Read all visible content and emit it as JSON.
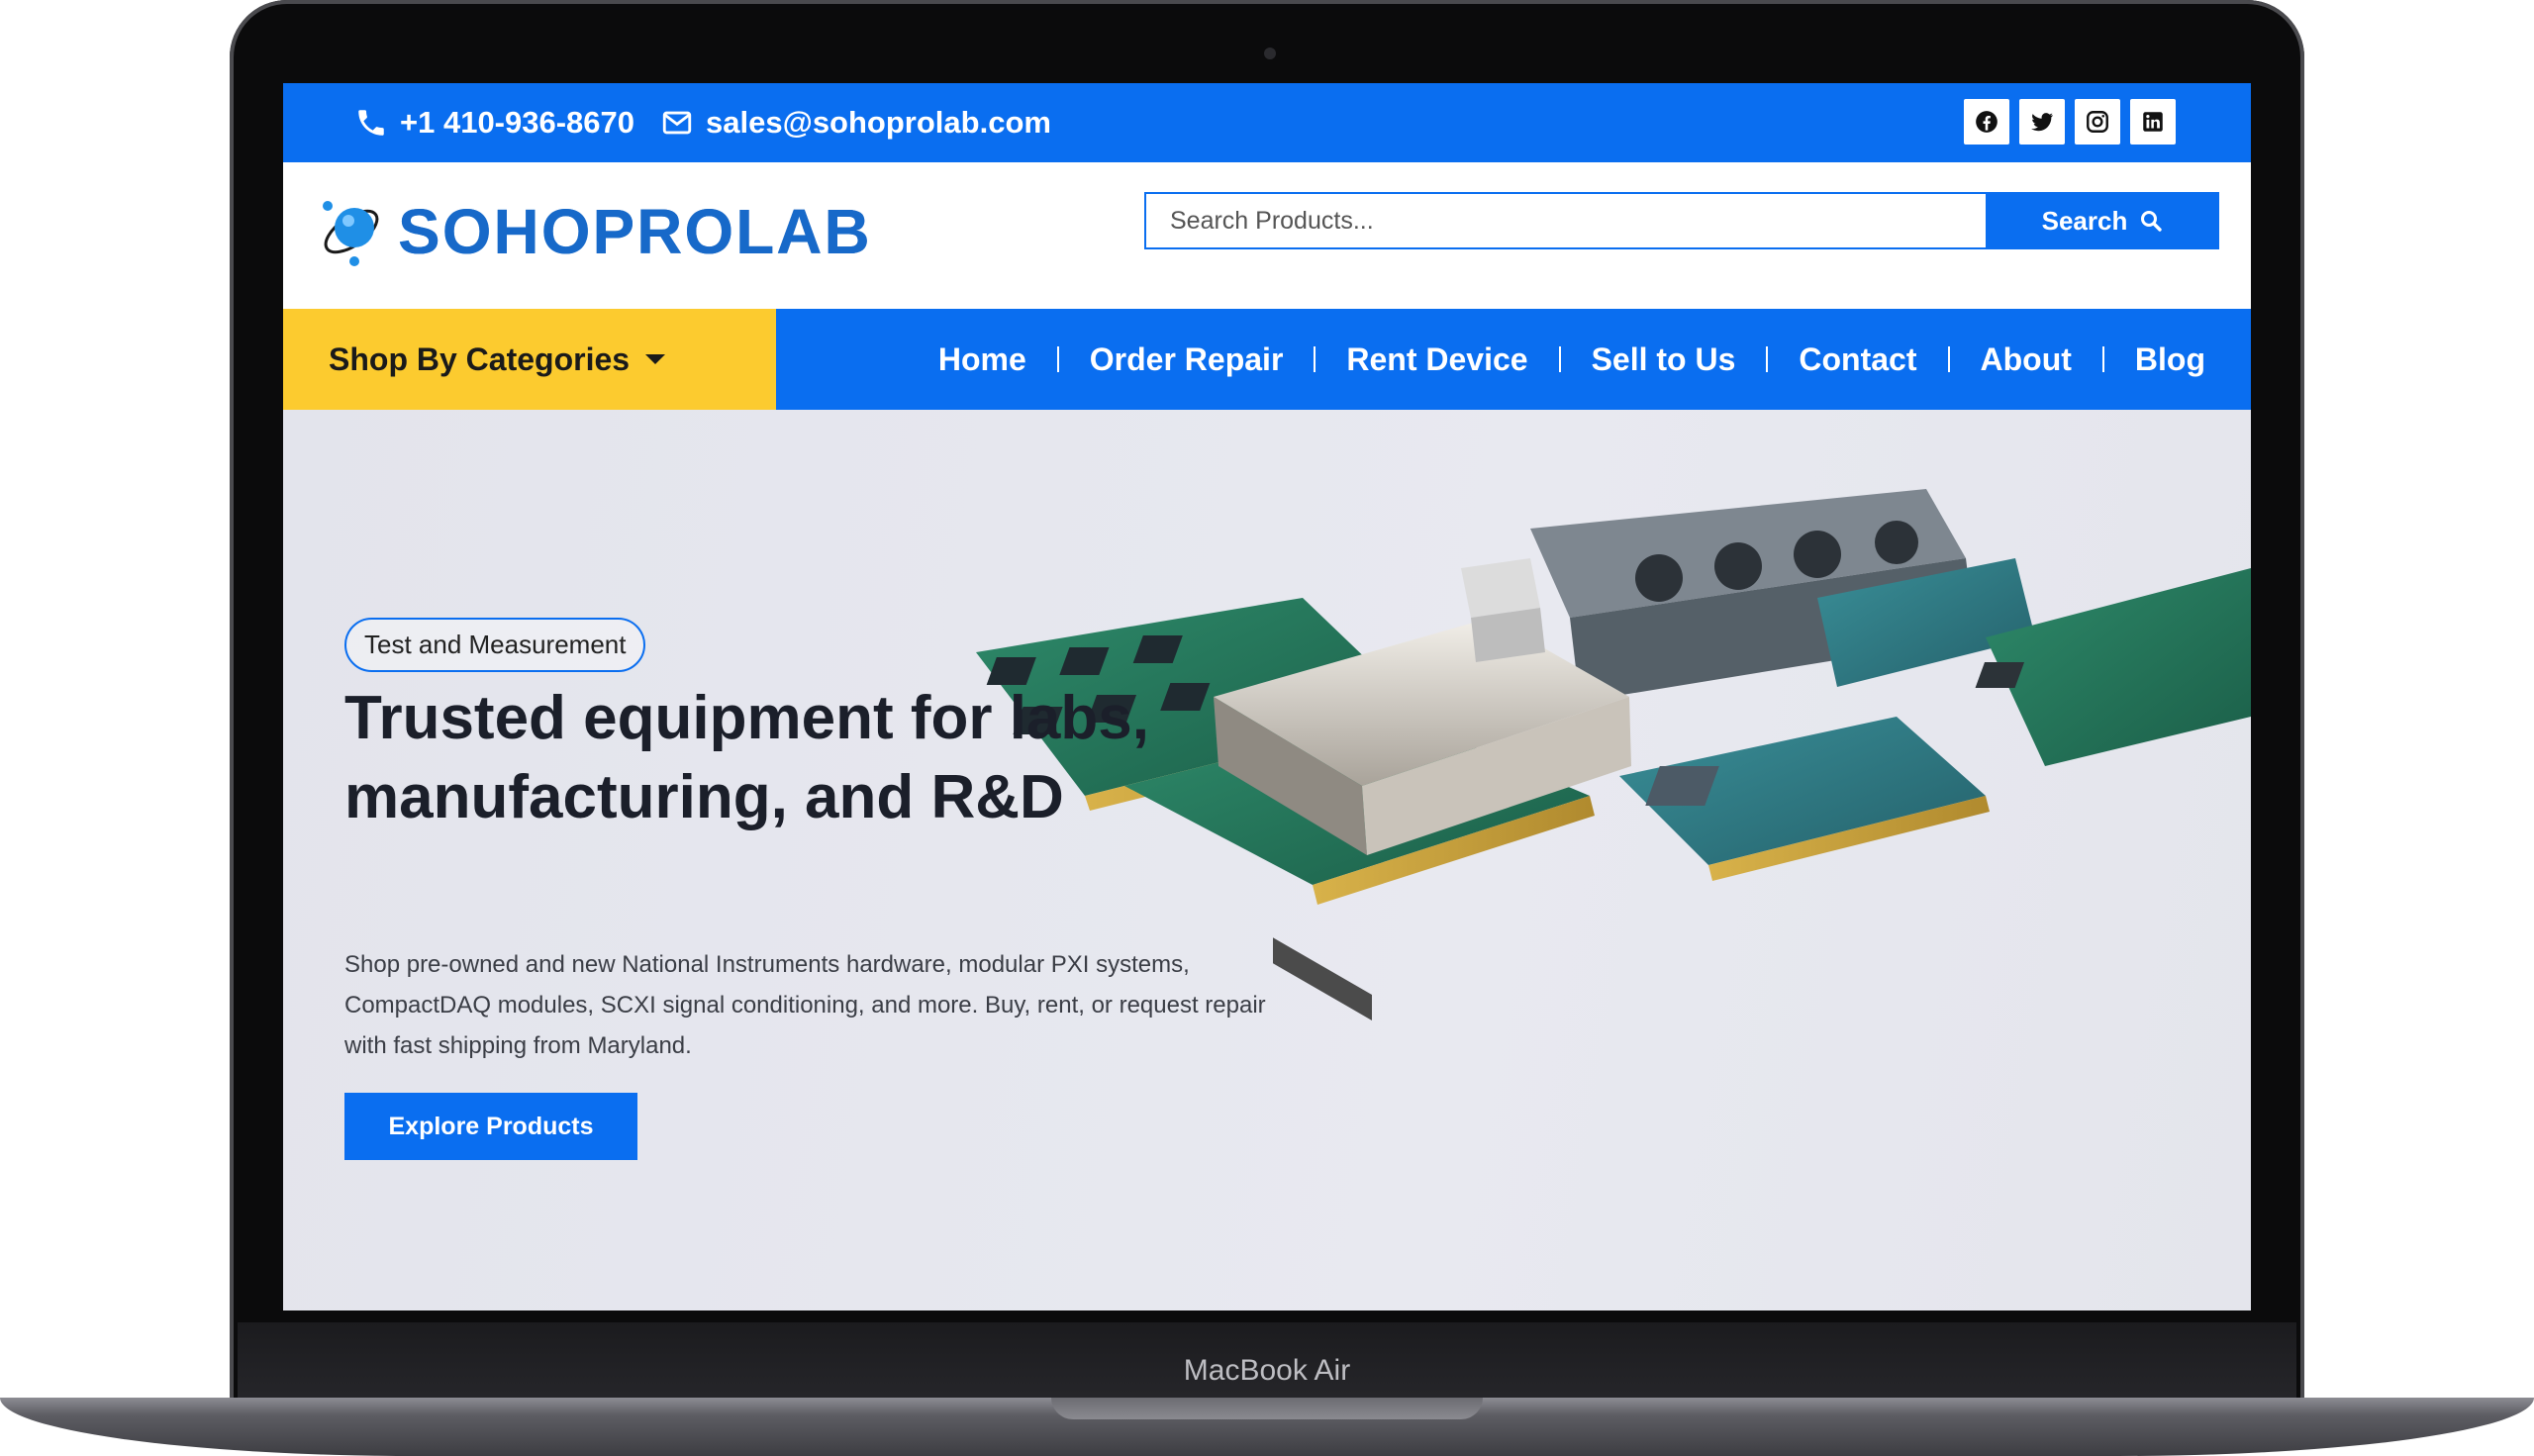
{
  "device": {
    "label": "MacBook Air"
  },
  "topbar": {
    "phone": "+1 410-936-8670",
    "email": "sales@sohoprolab.com",
    "social": [
      "facebook-icon",
      "twitter-icon",
      "instagram-icon",
      "linkedin-icon"
    ]
  },
  "header": {
    "logo_text": "SOHOPROLAB",
    "search": {
      "placeholder": "Search Products...",
      "button_label": "Search"
    }
  },
  "nav": {
    "categories_label": "Shop By Categories",
    "links": [
      "Home",
      "Order Repair",
      "Rent Device",
      "Sell to Us",
      "Contact",
      "About",
      "Blog"
    ]
  },
  "hero": {
    "badge": "Test and Measurement",
    "headline_line1": "Trusted equipment for labs,",
    "headline_line2": "manufacturing, and R&D",
    "description": "Shop pre-owned and new National Instruments hardware, modular PXI systems, CompactDAQ modules, SCXI signal conditioning, and more. Buy, rent, or request repair with fast shipping from Maryland.",
    "cta_label": "Explore Products"
  },
  "colors": {
    "primary": "#0a6ef0",
    "accent": "#fccb2f",
    "text": "#1b1f2a"
  }
}
